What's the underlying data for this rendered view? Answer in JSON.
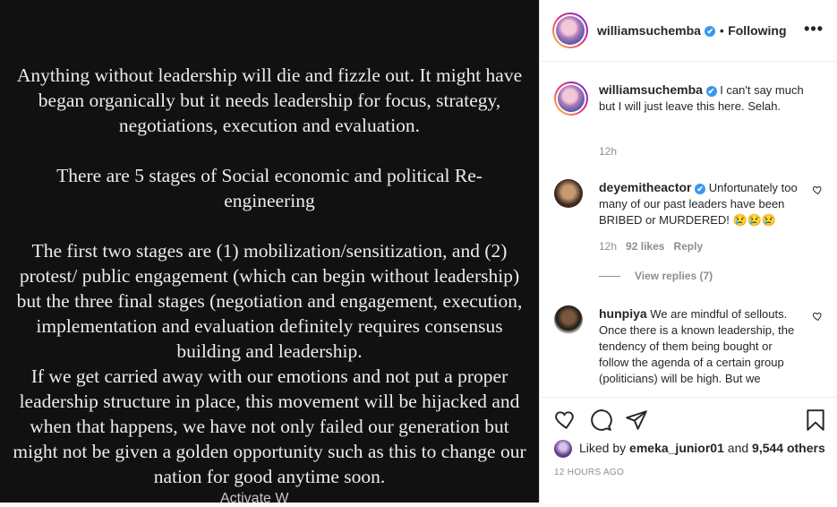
{
  "post": {
    "image_lines": [
      "Anything without leadership will die and fizzle out. It might have",
      "began organically but it needs leadership for focus, strategy,",
      "negotiations, execution and evaluation.",
      "",
      "There are 5 stages of Social economic and political Re-",
      "engineering",
      "",
      "The first two stages are  (1) mobilization/sensitization, and (2)",
      "protest/ public engagement (which can begin without leadership)",
      "but the three final stages (negotiation and engagement, execution,",
      "implementation and evaluation definitely requires consensus",
      "building and leadership.",
      "If we get carried away with our emotions and not put a proper",
      "leadership structure in place, this movement will be hijacked and",
      "when that happens, we have not only failed our generation but",
      "might not be given a golden opportunity such as this to change our",
      "nation for good anytime soon."
    ]
  },
  "header": {
    "username": "williamsuchemba",
    "verified_mark": "✔",
    "separator": "•",
    "follow_status": "Following",
    "more_label": "•••"
  },
  "caption": {
    "username": "williamsuchemba",
    "text": "I can't say much but I will just leave this here. Selah.",
    "time": "12h"
  },
  "comments": [
    {
      "username": "deyemitheactor",
      "verified": true,
      "text": "Unfortunately too many of our past leaders have been BRIBED or MURDERED! 😢😢😢",
      "time": "12h",
      "likes": "92 likes",
      "reply_label": "Reply",
      "view_replies": "View replies (7)"
    },
    {
      "username": "hunpiya",
      "verified": false,
      "text": "We are mindful of sellouts. Once there is a known leadership, the tendency of them being bought or follow the agenda of a certain group (politicians) will be high. But we"
    }
  ],
  "actions": {
    "icons": [
      "heart-icon",
      "comment-icon",
      "share-icon",
      "bookmark-icon"
    ],
    "liked_by_prefix": "Liked by",
    "liked_by_user": "emeka_junior01",
    "liked_by_and": "and",
    "liked_by_others": "9,544 others",
    "time_ago": "12 HOURS AGO"
  },
  "watermark": "Activate W",
  "colors": {
    "verified": "#3897f0",
    "text": "#262626",
    "muted": "#8e8e8e",
    "post_bg": "#111111"
  }
}
